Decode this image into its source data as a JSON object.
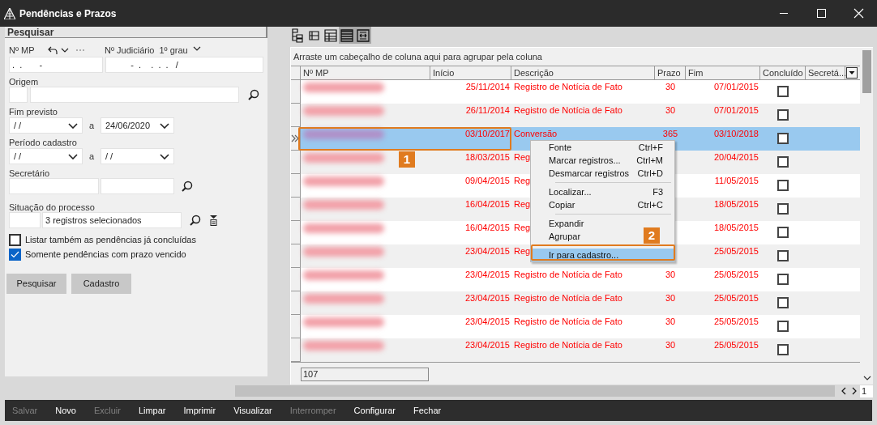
{
  "window": {
    "title": "Pendências e Prazos"
  },
  "search_panel": {
    "title": "Pesquisar",
    "n_mp": {
      "label": "Nº MP",
      "value": ".  .       -"
    },
    "n_judiciario": {
      "label": "Nº Judiciário",
      "grade": "1º grau",
      "value": "-  .    .  .  .   /"
    },
    "origem": {
      "label": "Origem"
    },
    "fim_previsto": {
      "label": "Fim previsto",
      "from": "/ /",
      "separator": "a",
      "to": "24/06/2020"
    },
    "periodo_cadastro": {
      "label": "Período cadastro",
      "from": "/ /",
      "separator": "a",
      "to": "/ /"
    },
    "secretario": {
      "label": "Secretário"
    },
    "situacao": {
      "label": "Situação do processo",
      "value": "3 registros selecionados"
    },
    "checkboxes": [
      {
        "label": "Listar também as pendências já concluídas",
        "checked": false
      },
      {
        "label": "Somente pendências com prazo vencido",
        "checked": true
      }
    ],
    "buttons": [
      "Pesquisar",
      "Cadastro"
    ]
  },
  "grid_toolbar": [
    {
      "selected": false
    },
    {
      "selected": false
    },
    {
      "selected": false
    },
    {
      "selected": true
    },
    {
      "selected": true
    }
  ],
  "grid": {
    "group_hint": "Arraste um cabeçalho de coluna aqui para agrupar pela coluna",
    "columns": [
      "Nº MP",
      "Início",
      "Descrição",
      "Prazo",
      "Fim",
      "Concluído",
      "Secretá..."
    ],
    "rows": [
      {
        "inicio": "25/11/2014",
        "descricao": "Registro de Notícia de Fato",
        "prazo": "30",
        "fim": "07/01/2015",
        "concluido": false,
        "selected": false
      },
      {
        "inicio": "26/11/2014",
        "descricao": "Registro de Notícia de Fato",
        "prazo": "30",
        "fim": "07/01/2015",
        "concluido": false,
        "selected": false
      },
      {
        "inicio": "03/10/2017",
        "descricao": "Conversão",
        "prazo": "365",
        "fim": "03/10/2018",
        "concluido": false,
        "selected": true
      },
      {
        "inicio": "18/03/2015",
        "descricao": "Reg",
        "fim": "20/04/2015",
        "concluido": false,
        "selected": false
      },
      {
        "inicio": "09/04/2015",
        "descricao": "Reg",
        "fim": "11/05/2015",
        "concluido": false,
        "selected": false
      },
      {
        "inicio": "16/04/2015",
        "descricao": "Reg",
        "fim": "18/05/2015",
        "concluido": false,
        "selected": false
      },
      {
        "inicio": "16/04/2015",
        "descricao": "Reg",
        "fim": "18/05/2015",
        "concluido": false,
        "selected": false
      },
      {
        "inicio": "23/04/2015",
        "descricao": "Reg",
        "fim": "25/05/2015",
        "concluido": false,
        "selected": false
      },
      {
        "inicio": "23/04/2015",
        "descricao": "Registro de Notícia de Fato",
        "prazo": "30",
        "fim": "25/05/2015",
        "concluido": false,
        "selected": false
      },
      {
        "inicio": "23/04/2015",
        "descricao": "Registro de Notícia de Fato",
        "prazo": "30",
        "fim": "25/05/2015",
        "concluido": false,
        "selected": false
      },
      {
        "inicio": "23/04/2015",
        "descricao": "Registro de Notícia de Fato",
        "prazo": "30",
        "fim": "25/05/2015",
        "concluido": false,
        "selected": false
      },
      {
        "inicio": "23/04/2015",
        "descricao": "Registro de Notícia de Fato",
        "prazo": "30",
        "fim": "25/05/2015",
        "concluido": false,
        "selected": false
      }
    ],
    "record_count": "107"
  },
  "context_menu": [
    {
      "kind": "item",
      "label": "Fonte",
      "shortcut": "Ctrl+F",
      "selected": false
    },
    {
      "kind": "item",
      "label": "Marcar registros...",
      "shortcut": "Ctrl+M",
      "selected": false
    },
    {
      "kind": "item",
      "label": "Desmarcar registros",
      "shortcut": "Ctrl+D",
      "selected": false
    },
    {
      "kind": "separator"
    },
    {
      "kind": "item",
      "label": "Localizar...",
      "shortcut": "F3",
      "selected": false
    },
    {
      "kind": "item",
      "label": "Copiar",
      "shortcut": "Ctrl+C",
      "selected": false
    },
    {
      "kind": "separator"
    },
    {
      "kind": "item",
      "label": "Expandir",
      "selected": false
    },
    {
      "kind": "item",
      "label": "Agrupar",
      "selected": false
    },
    {
      "kind": "separator"
    },
    {
      "kind": "item",
      "label": "Ir para cadastro...",
      "selected": true
    }
  ],
  "callouts": [
    "1",
    "2"
  ],
  "pager": {
    "page": "1"
  },
  "action_bar": [
    {
      "label": "Salvar",
      "disabled": true
    },
    {
      "label": "Novo",
      "disabled": false
    },
    {
      "label": "Excluir",
      "disabled": true
    },
    {
      "label": "Limpar",
      "disabled": false
    },
    {
      "label": "Imprimir",
      "disabled": false
    },
    {
      "label": "Visualizar",
      "disabled": false
    },
    {
      "label": "Interromper",
      "disabled": true
    },
    {
      "label": "Configurar",
      "disabled": false
    },
    {
      "label": "Fechar",
      "disabled": false
    }
  ]
}
